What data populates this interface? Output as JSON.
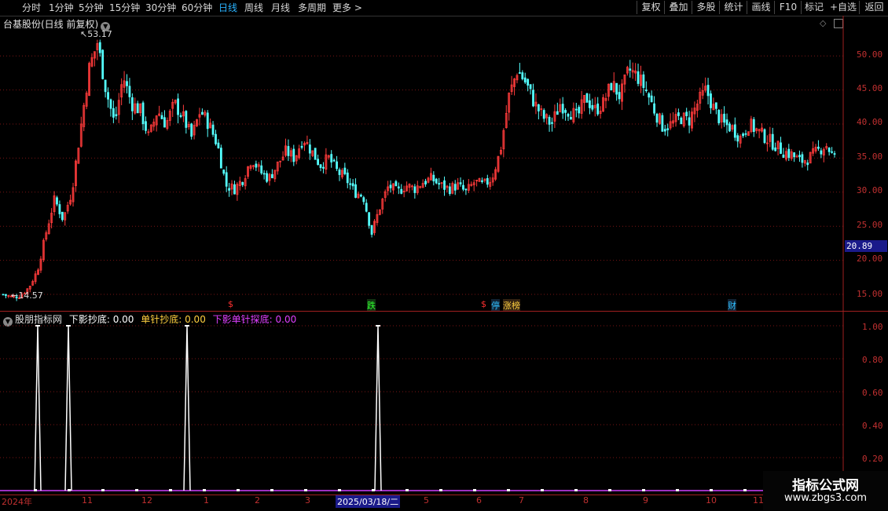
{
  "toolbar": {
    "periods": [
      "分时",
      "1分钟",
      "5分钟",
      "15分钟",
      "30分钟",
      "60分钟",
      "日线",
      "周线",
      "月线",
      "多周期",
      "更多 >"
    ],
    "active": "日线",
    "buttons": [
      "复权",
      "叠加",
      "多股",
      "统计",
      "画线",
      "F10",
      "+自选",
      "返回"
    ]
  },
  "chart": {
    "title": "台基股份(日线 前复权)",
    "high_label": "53.17",
    "low_label": "14.57",
    "current_price": "20.89",
    "y_ticks": [
      "50.00",
      "45.00",
      "40.00",
      "35.00",
      "30.00",
      "25.00",
      "20.00",
      "15.00"
    ],
    "event_markers": [
      {
        "text": "$",
        "color": "#ff3030"
      },
      {
        "text": "跌",
        "color": "#30ff30"
      },
      {
        "text": "$",
        "color": "#ff3030"
      },
      {
        "text": "停",
        "color": "#30c0ff"
      },
      {
        "text": "涨榜",
        "color": "#ffd040"
      },
      {
        "text": "财",
        "color": "#30c0ff"
      }
    ]
  },
  "indicator": {
    "name": "股朋指标网",
    "lines": [
      {
        "label": "下影抄底: 0.00",
        "color": "#ffffff"
      },
      {
        "label": "单针抄底: 0.00",
        "color": "#ffd040"
      },
      {
        "label": "下影单针探底: 0.00",
        "color": "#e040ff"
      }
    ],
    "y_ticks": [
      "1.00",
      "0.80",
      "0.60",
      "0.40",
      "0.20"
    ]
  },
  "x_axis": {
    "labels": [
      "2024年",
      "11",
      "12",
      "1",
      "2",
      "3",
      "2025/03/18/二",
      "5",
      "6",
      "7",
      "8",
      "9",
      "10",
      "11"
    ]
  },
  "watermark": {
    "line1": "指标公式网",
    "line2": "www.zbgs3.com"
  },
  "chart_data": {
    "type": "candlestick",
    "title": "台基股份(日线 前复权)",
    "ylim": [
      12.5,
      54
    ],
    "close_path": [
      15.0,
      14.6,
      14.8,
      16.0,
      18.5,
      24.0,
      29.0,
      26.0,
      30.0,
      39.0,
      48.0,
      52.0,
      45.0,
      40.0,
      47.0,
      43.0,
      42.0,
      38.0,
      42.0,
      40.0,
      43.0,
      41.0,
      38.0,
      42.0,
      40.0,
      37.0,
      31.0,
      30.5,
      32.0,
      35.0,
      33.0,
      32.0,
      34.0,
      36.0,
      35.0,
      38.0,
      36.0,
      34.0,
      35.0,
      33.0,
      32.0,
      30.0,
      29.5,
      24.0,
      28.0,
      31.0,
      30.0,
      31.0,
      30.5,
      31.5,
      32.0,
      31.0,
      30.5,
      31.0,
      30.0,
      31.5,
      31.0,
      32.0,
      36.0,
      44.0,
      48.0,
      46.0,
      43.0,
      41.0,
      40.0,
      43.0,
      42.0,
      41.0,
      44.0,
      42.0,
      43.0,
      46.0,
      44.0,
      48.0,
      47.0,
      45.0,
      42.0,
      39.5,
      40.0,
      41.0,
      40.5,
      43.0,
      45.0,
      42.0,
      40.0,
      39.5,
      38.0,
      40.0,
      39.0,
      38.0,
      37.0,
      36.0,
      35.5,
      34.5,
      35.0,
      36.0,
      37.0,
      35.0
    ]
  }
}
